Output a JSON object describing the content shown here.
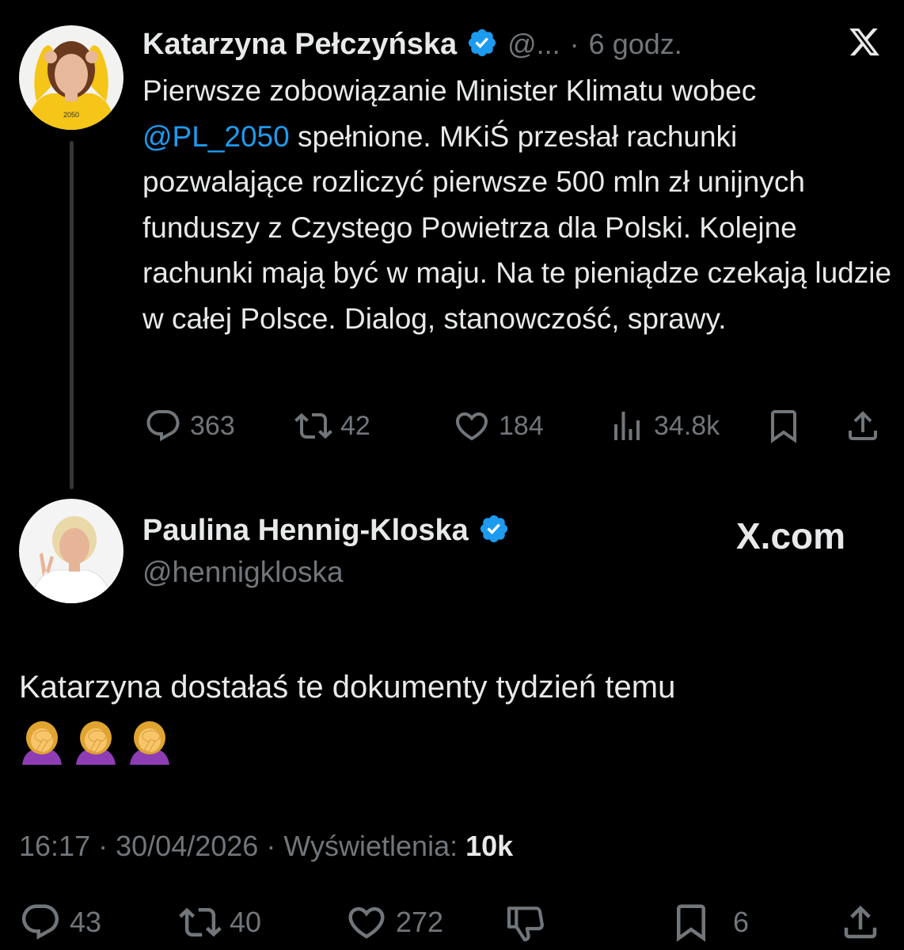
{
  "colors": {
    "background": "#000000",
    "text_primary": "#e7e9ea",
    "text_secondary": "#71767b",
    "accent": "#1d9bf0",
    "verified": "#1d9bf0"
  },
  "quoted_tweet": {
    "author_name": "Katarzyna Pełczyńska",
    "handle": "@...",
    "separator": "·",
    "time": "6 godz.",
    "text_before_mention": "Pierwsze zobowiązanie Minister Klimatu wobec ",
    "mention": "@PL_2050",
    "text_after_mention": " spełnione. MKiŚ przesłał rachunki pozwalające rozliczyć pierwsze 500 mln zł unijnych funduszy z Czystego Powietrza dla Polski. Kolejne rachunki mają być w maju. Na te pieniądze czekają ludzie w całej Polsce. Dialog, stanowczość, sprawy.",
    "avatar_shirt_text": "2050",
    "stats": {
      "replies": "363",
      "reposts": "42",
      "likes": "184",
      "views": "34.8k"
    }
  },
  "main_tweet": {
    "author_name": "Paulina Hennig-Kloska",
    "handle": "@hennigkloska",
    "watermark": "X.com",
    "text": "Katarzyna dostałaś te dokumenty tydzień temu",
    "emojis": [
      "facepalm-woman-emoji",
      "facepalm-woman-emoji",
      "facepalm-woman-emoji"
    ],
    "time": "16:17",
    "separator": "·",
    "date": "30/04/2026",
    "views_label": "Wyświetlenia:",
    "views_value": "10k",
    "stats": {
      "replies": "43",
      "reposts": "40",
      "likes": "272",
      "bookmarks": "6"
    }
  },
  "icons": {
    "close": "x-logo-icon",
    "reply": "reply-icon",
    "repost": "repost-icon",
    "like": "heart-icon",
    "views": "views-icon",
    "bookmark": "bookmark-icon",
    "share": "share-icon",
    "dislike": "thumbs-down-icon"
  }
}
